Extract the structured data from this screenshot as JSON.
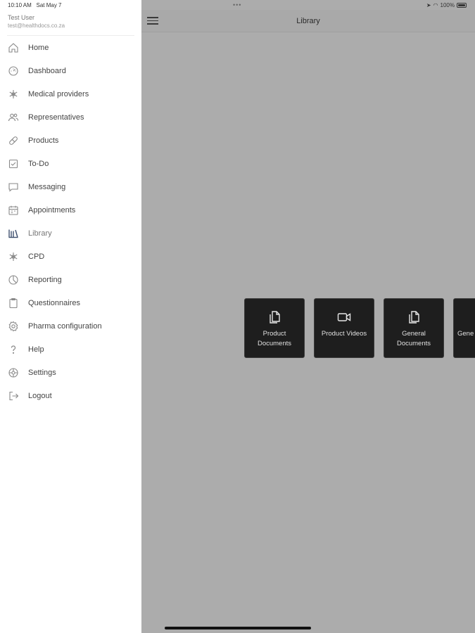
{
  "status_bar": {
    "time": "10:10 AM",
    "date": "Sat May 7",
    "dots": "•••",
    "battery": "100%"
  },
  "user": {
    "name": "Test User",
    "email": "test@healthdocs.co.za"
  },
  "sidebar": {
    "items": [
      {
        "label": "Home",
        "icon": "home-icon"
      },
      {
        "label": "Dashboard",
        "icon": "dashboard-icon"
      },
      {
        "label": "Medical providers",
        "icon": "star-of-life-icon"
      },
      {
        "label": "Representatives",
        "icon": "people-icon"
      },
      {
        "label": "Products",
        "icon": "pill-icon"
      },
      {
        "label": "To-Do",
        "icon": "checkbox-icon"
      },
      {
        "label": "Messaging",
        "icon": "chat-icon"
      },
      {
        "label": "Appointments",
        "icon": "calendar-icon"
      },
      {
        "label": "Library",
        "icon": "library-icon",
        "active": true
      },
      {
        "label": "CPD",
        "icon": "star-of-life-icon"
      },
      {
        "label": "Reporting",
        "icon": "pie-chart-icon"
      },
      {
        "label": "Questionnaires",
        "icon": "clipboard-icon"
      },
      {
        "label": "Pharma configuration",
        "icon": "gear-icon"
      },
      {
        "label": "Help",
        "icon": "question-icon"
      },
      {
        "label": "Settings",
        "icon": "settings-icon"
      },
      {
        "label": "Logout",
        "icon": "logout-icon"
      }
    ]
  },
  "header": {
    "title": "Library"
  },
  "tiles": [
    {
      "label": "Product Documents",
      "icon": "documents-icon"
    },
    {
      "label": "Product Videos",
      "icon": "video-camera-icon"
    },
    {
      "label": "General Documents",
      "icon": "documents-icon"
    },
    {
      "label": "Gene",
      "icon": "video-camera-icon"
    }
  ],
  "colors": {
    "main_background": "#acacac",
    "tile_background": "#1e1e1e",
    "sidebar_background": "#ffffff"
  }
}
